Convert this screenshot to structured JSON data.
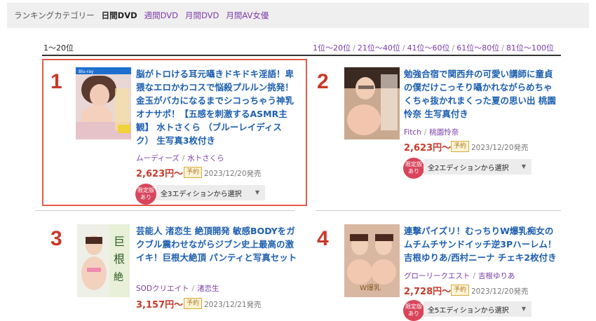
{
  "tabs": {
    "category_label": "ランキングカテゴリー",
    "items": [
      {
        "label": "日間DVD",
        "active": true
      },
      {
        "label": "週間DVD",
        "active": false
      },
      {
        "label": "月間DVD",
        "active": false
      },
      {
        "label": "月間AV女優",
        "active": false
      }
    ]
  },
  "range": {
    "current": "1〜20位",
    "links": [
      "1位〜20位",
      "21位〜40位",
      "41位〜60位",
      "61位〜80位",
      "81位〜100位"
    ],
    "separator": "/"
  },
  "products": [
    {
      "rank": "1",
      "title": "脳がトロける耳元囁きドキドキ淫語！卑猥なエロかわコスで悩殺プルルン挑発！金玉がバカになるまでシコっちゃう神乳オナサポ！【五感を刺激するASMR主観】 水トさくら （ブルーレイディスク） 生写真3枚付き",
      "maker": "ムーディーズ",
      "actress": "水トさくら",
      "price": "2,623円〜",
      "badge": "予約",
      "date": "2023/12/20発売",
      "limited": "限定版あり",
      "edition": "全3エディションから選択"
    },
    {
      "rank": "2",
      "title": "勉強合宿で関西弁の可愛い講師に童貞の僕だけこっそり囁かれながらめちゃくちゃ抜かれまくった夏の思い出 桃園怜奈 生写真付き",
      "maker": "Fitch",
      "actress": "桃園怜奈",
      "price": "2,623円〜",
      "badge": "予約",
      "date": "2023/12/20発売",
      "limited": "限定版あり",
      "edition": "全2エディションから選択"
    },
    {
      "rank": "3",
      "title": "芸能人 渚恋生 絶頂開発 敏感BODYをガクブル震わせながらジブン史上最高の激イキ！巨根大絶頂 パンティと写真セット",
      "maker": "SODクリエイト",
      "actress": "渚恋生",
      "price": "3,157円〜",
      "badge": "予約",
      "date": "2023/12/21発売",
      "limited": "",
      "edition": ""
    },
    {
      "rank": "4",
      "title": "連撃パイズリ！むっちりW爆乳痴女のムチムチサンドイッチ逆3Pハーレム！吉根ゆりあ/西村ニーナ チェキ2枚付き",
      "maker": "グローリークエスト",
      "actress": "吉根ゆりあ",
      "price": "2,728円〜",
      "badge": "予約",
      "date": "2023/12/20発売",
      "limited": "限定版あり",
      "edition": "全5エディションから選択"
    }
  ],
  "icons": {
    "dropdown": "triangle-down-icon"
  },
  "colors": {
    "rank": "#c8392b",
    "title": "#1d5fb0",
    "link": "#7a3aa8",
    "highlight_border": "#e15b4a",
    "limited_badge": "#d8455b"
  }
}
